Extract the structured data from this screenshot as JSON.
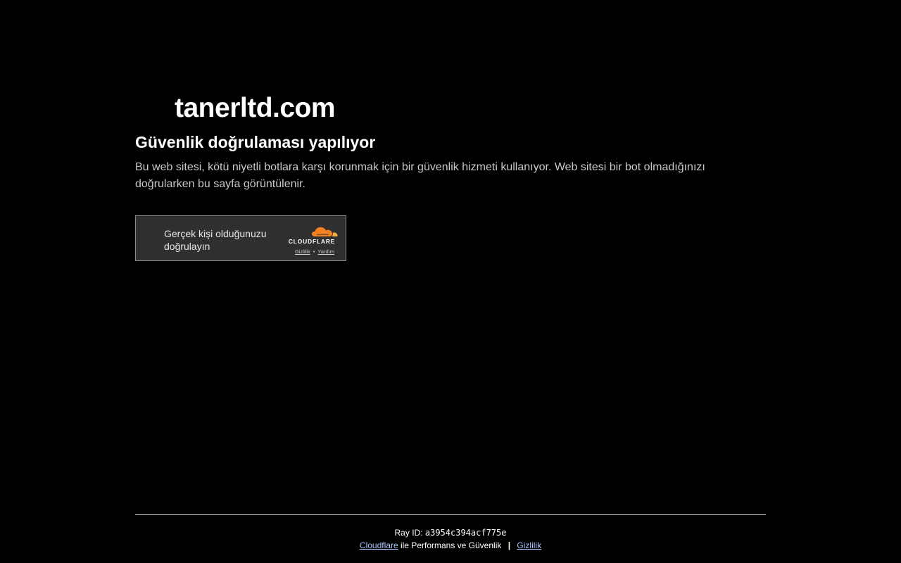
{
  "site": {
    "name": "tanerltd.com"
  },
  "challenge": {
    "heading": "Güvenlik doğrulaması yapılıyor",
    "description": "Bu web sitesi, kötü niyetli botlara karşı korunmak için bir güvenlik hizmeti kullanıyor. Web sitesi bir bot olmadığınızı doğrularken bu sayfa görüntülenir."
  },
  "widget": {
    "label": "Gerçek kişi olduğunuzu doğrulayın",
    "brand": "CLOUDFLARE",
    "privacy_link": "Gizlilik",
    "separator": "•",
    "help_link": "Yardım",
    "icon": "cloudflare-logo-icon",
    "colors": {
      "background": "#2f2f2f",
      "border": "#8a8a8a",
      "cloud_orange": "#f48120",
      "cloud_light_orange": "#faad3f"
    }
  },
  "footer": {
    "ray_id_label": "Ray ID:",
    "ray_id_value": "a3954c394acf775e",
    "cloudflare_link": "Cloudflare",
    "performance_text": "ile Performans ve Güvenlik",
    "separator": "|",
    "privacy_link": "Gizlilik",
    "link_color": "#a6c4ff"
  }
}
